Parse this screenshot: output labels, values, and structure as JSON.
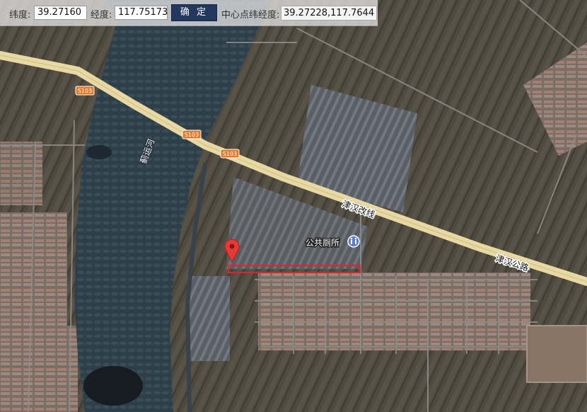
{
  "toolbar": {
    "lat_label": "纬度:",
    "lat_value": "39.27160",
    "lng_label": "经度:",
    "lng_value": "117.75173",
    "confirm_label": "确 定",
    "center_label": "中心点纬经度:",
    "center_value": "39.27228,117.7644"
  },
  "map": {
    "road_badges": [
      "S103",
      "S103",
      "S103"
    ],
    "road_labels": [
      "津汉改线",
      "津汉公路"
    ],
    "river_label": "蓟运河",
    "poi_label": "公共厕所",
    "poi_icon": "toilet-icon",
    "marker_icon": "map-pin-icon",
    "selection_color": "#e0242d",
    "marker_color": "#e53935",
    "road_color": "#e8d9a2"
  }
}
